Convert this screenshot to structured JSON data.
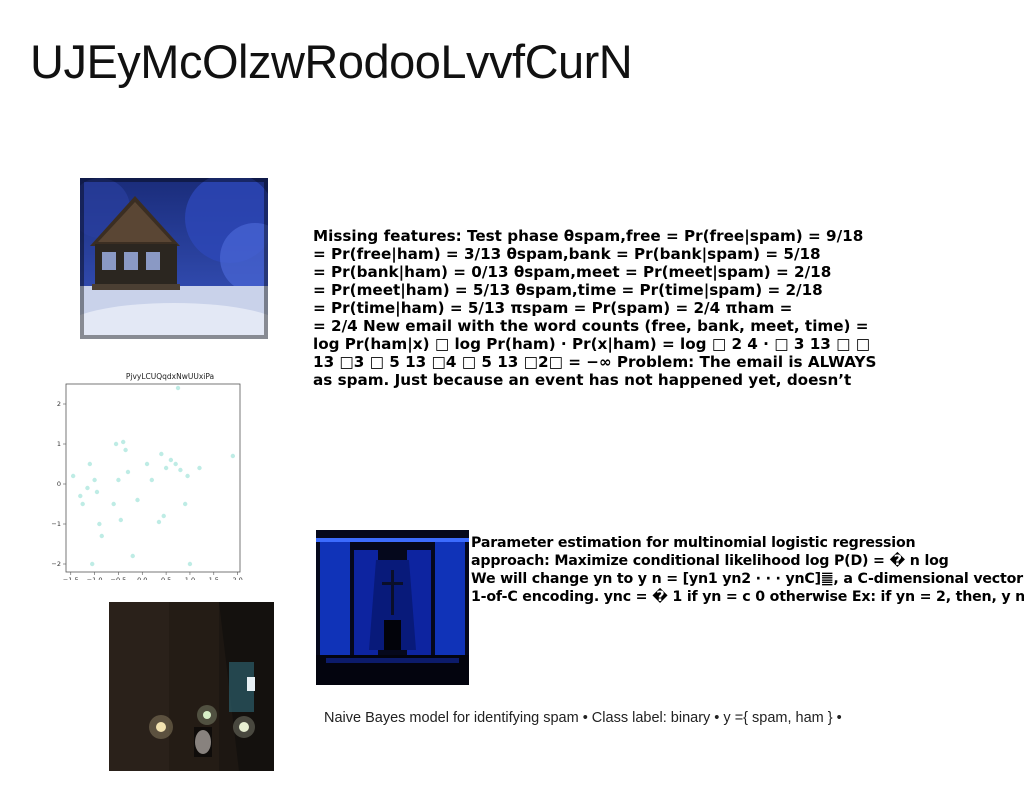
{
  "slide": {
    "title": "UJEyMcOlzwRodooLvvfCurN"
  },
  "main_text": {
    "lines": [
      "Missing features: Test phase θspam,free = Pr(free|spam) = 9/18",
      "= Pr(free|ham) = 3/13 θspam,bank = Pr(bank|spam) = 5/18",
      "= Pr(bank|ham) = 0/13 θspam,meet = Pr(meet|spam) = 2/18",
      "= Pr(meet|ham) = 5/13 θspam,time = Pr(time|spam) = 2/18",
      "= Pr(time|ham) = 5/13 πspam = Pr(spam) = 2/4 πham =",
      "= 2/4 New email with the word counts (free, bank, meet, time) =",
      "log Pr(ham|x) □ log Pr(ham) · Pr(x|ham) = log □ 2 4 · □ 3 13 □ □",
      "13 □3 □ 5 13 □4 □ 5 13 □2□ = −∞ Problem: The email is ALWAYS",
      "as spam. Just because an event has not happened yet, doesn’t"
    ]
  },
  "param_text": {
    "lines": [
      "Parameter estimation for multinomial logistic regression",
      "approach: Maximize conditional likelihood log P(D) = � n log",
      "We will change yn to y n = [yn1 yn2 · · · ynC]䷀, a C-dimensional vector",
      "1-of-C encoding. ync = � 1 if yn = c 0 otherwise Ex: if yn = 2, then, y n"
    ]
  },
  "caption": {
    "text": "Naive Bayes model for identifying spam • Class label: binary • y ={ spam, ham } •"
  },
  "chart_data": {
    "type": "scatter",
    "title": "PjvyLCUQqdxNwUUxiPa",
    "xlabel": "",
    "ylabel": "",
    "xlim": [
      -1.6,
      2.05
    ],
    "ylim": [
      -2.2,
      2.5
    ],
    "xticks": [
      "−1.5",
      "−1.0",
      "−0.5",
      "0.0",
      "0.5",
      "1.0",
      "1.5",
      "2.0"
    ],
    "xtick_values": [
      -1.5,
      -1.0,
      -0.5,
      0.0,
      0.5,
      1.0,
      1.5,
      2.0
    ],
    "yticks": [
      "−2",
      "−1",
      "0",
      "1",
      "2"
    ],
    "ytick_values": [
      -2,
      -1,
      0,
      1,
      2
    ],
    "grid": false,
    "point_color": "#a8e6dc",
    "series": [
      {
        "x": [
          -1.45,
          -1.3,
          -1.25,
          -1.1,
          -1.05,
          -1.0,
          -0.95,
          -0.9,
          -0.85,
          -0.6,
          -0.55,
          -0.5,
          -0.45,
          -0.4,
          -0.35,
          -0.3,
          -0.1,
          0.1,
          0.2,
          0.35,
          0.4,
          0.45,
          0.5,
          0.6,
          0.7,
          0.75,
          0.8,
          0.9,
          0.95,
          1.0,
          1.2,
          1.9,
          -0.2,
          -1.15
        ],
        "y": [
          0.2,
          -0.3,
          -0.5,
          0.5,
          -2.0,
          0.1,
          -0.2,
          -1.0,
          -1.3,
          -0.5,
          1.0,
          0.1,
          -0.9,
          1.05,
          0.85,
          0.3,
          -0.4,
          0.5,
          0.1,
          -0.95,
          0.75,
          -0.8,
          0.4,
          0.6,
          0.5,
          2.4,
          0.35,
          -0.5,
          0.2,
          -2.0,
          0.4,
          0.7,
          -1.8,
          -0.1
        ]
      }
    ]
  },
  "images": {
    "house": "snowy-wooden-house-photo",
    "church": "blue-lit-church-interior-photo",
    "room": "dark-room-with-lamps-photo"
  }
}
